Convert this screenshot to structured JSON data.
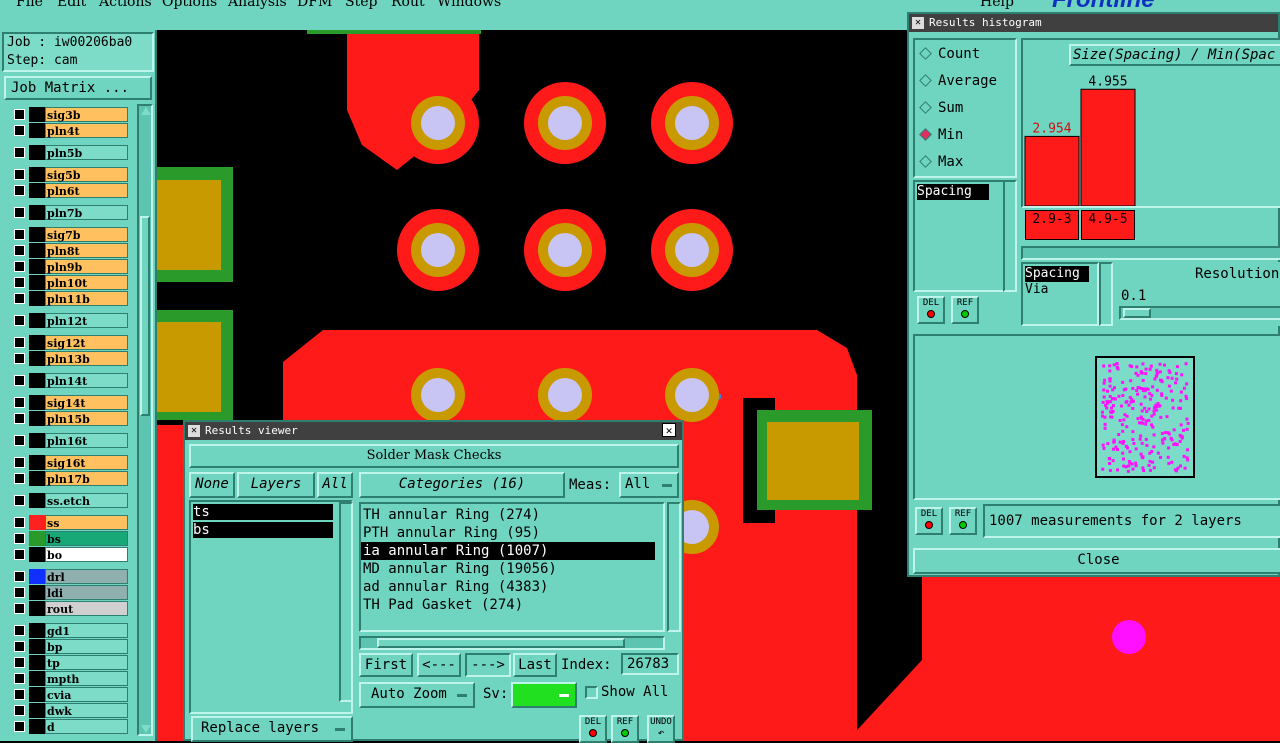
{
  "menubar": {
    "items": [
      "File",
      "Edit",
      "Actions",
      "Options",
      "Analysis",
      "DFM",
      "Step",
      "Rout",
      "Windows"
    ],
    "help": "Help",
    "brand": "Frontline"
  },
  "job": {
    "job_label": "Job : iw00206ba0",
    "step_label": "Step: cam",
    "matrix_button": "Job Matrix ..."
  },
  "layers": [
    {
      "name": "sig3b",
      "color": "#ffc060",
      "swatch": "#000"
    },
    {
      "name": "pln4t",
      "color": "#ffc060",
      "swatch": "#000"
    },
    {
      "name": "pln5b",
      "color": "#7cdcc8",
      "swatch": "#000"
    },
    {
      "name": "sig5b",
      "color": "#ffc060",
      "swatch": "#000"
    },
    {
      "name": "pln6t",
      "color": "#ffc060",
      "swatch": "#000"
    },
    {
      "name": "pln7b",
      "color": "#7cdcc8",
      "swatch": "#000"
    },
    {
      "name": "sig7b",
      "color": "#ffc060",
      "swatch": "#000"
    },
    {
      "name": "pln8t",
      "color": "#ffc060",
      "swatch": "#000"
    },
    {
      "name": "pln9b",
      "color": "#ffc060",
      "swatch": "#000"
    },
    {
      "name": "pln10t",
      "color": "#ffc060",
      "swatch": "#000"
    },
    {
      "name": "pln11b",
      "color": "#ffc060",
      "swatch": "#000"
    },
    {
      "name": "pln12t",
      "color": "#7cdcc8",
      "swatch": "#000"
    },
    {
      "name": "sig12t",
      "color": "#ffc060",
      "swatch": "#000"
    },
    {
      "name": "pln13b",
      "color": "#ffc060",
      "swatch": "#000"
    },
    {
      "name": "pln14t",
      "color": "#7cdcc8",
      "swatch": "#000"
    },
    {
      "name": "sig14t",
      "color": "#ffc060",
      "swatch": "#000"
    },
    {
      "name": "pln15b",
      "color": "#ffc060",
      "swatch": "#000"
    },
    {
      "name": "pln16t",
      "color": "#7cdcc8",
      "swatch": "#000"
    },
    {
      "name": "sig16t",
      "color": "#ffc060",
      "swatch": "#000"
    },
    {
      "name": "pln17b",
      "color": "#ffc060",
      "swatch": "#000"
    },
    {
      "name": "ss.etch",
      "color": "#7cdcc8",
      "swatch": "#000"
    },
    {
      "name": "ss",
      "color": "#ffc060",
      "swatch": "#ff2020"
    },
    {
      "name": "bs",
      "color": "#18a878",
      "swatch": "#2a9a2a"
    },
    {
      "name": "bo",
      "color": "#ffffff",
      "swatch": "#000"
    },
    {
      "name": "drl",
      "color": "#90b0b0",
      "swatch": "#1030ff"
    },
    {
      "name": "ldi",
      "color": "#90b0b0",
      "swatch": "#000"
    },
    {
      "name": "rout",
      "color": "#d0d0d0",
      "swatch": "#000"
    },
    {
      "name": "gd1",
      "color": "#7cdcc8",
      "swatch": "#000"
    },
    {
      "name": "bp",
      "color": "#7cdcc8",
      "swatch": "#000"
    },
    {
      "name": "tp",
      "color": "#7cdcc8",
      "swatch": "#000"
    },
    {
      "name": "mpth",
      "color": "#7cdcc8",
      "swatch": "#000"
    },
    {
      "name": "cvia",
      "color": "#7cdcc8",
      "swatch": "#000"
    },
    {
      "name": "dwk",
      "color": "#7cdcc8",
      "swatch": "#000"
    },
    {
      "name": "d",
      "color": "#7cdcc8",
      "swatch": "#000"
    }
  ],
  "results_viewer": {
    "title": "Results viewer",
    "header": "Solder Mask Checks",
    "none_label": "None",
    "layers_label": "Layers",
    "all_label": "All",
    "categories_label": "Categories (16)",
    "meas_label": "Meas:",
    "meas_value": "All",
    "layer_items": [
      "ts",
      "bs"
    ],
    "category_items": [
      "TH annular Ring (274)",
      "PTH annular Ring (95)",
      "ia annular Ring (1007)",
      "MD annular Ring (19056)",
      "ad annular Ring (4383)",
      "TH Pad Gasket (274)"
    ],
    "first": "First",
    "prev": "<---",
    "next": "--->",
    "last": "Last",
    "index_label": "Index:",
    "index_value": "26783",
    "auto_zoom": "Auto Zoom",
    "sv_label": "Sv:",
    "show_all": "Show All",
    "replace_layers": "Replace layers",
    "del": "DEL",
    "ref": "REF",
    "undo": "UNDO"
  },
  "histogram": {
    "title": "Results histogram",
    "modes": [
      "Count",
      "Average",
      "Sum",
      "Min",
      "Max"
    ],
    "selected_mode": "Min",
    "chart_title": "Size(Spacing) / Min(Spac",
    "bars": [
      {
        "label": "2.954",
        "range": "2.9-3",
        "value": 2.954
      },
      {
        "label": "4.955",
        "range": "4.9-5",
        "value": 4.955
      }
    ],
    "spacing_list": [
      "Spacing"
    ],
    "types_list": [
      "Spacing",
      "Via"
    ],
    "resolution_label": "Resolution",
    "resolution_value": "0.1",
    "status": "1007 measurements for 2 layers",
    "close": "Close",
    "del": "DEL",
    "ref": "REF"
  }
}
